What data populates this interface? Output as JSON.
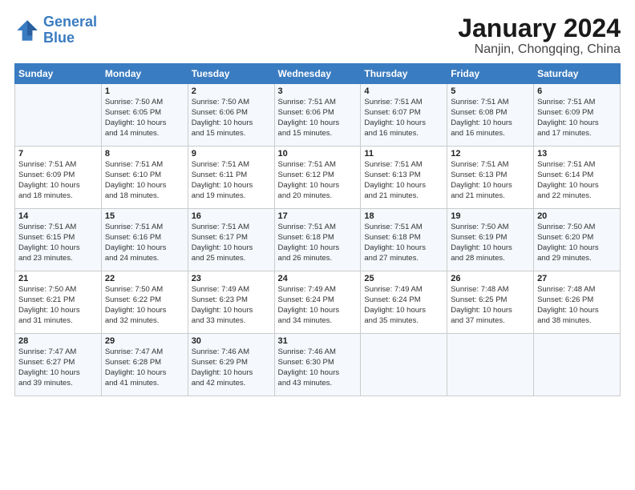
{
  "logo": {
    "line1": "General",
    "line2": "Blue"
  },
  "title": "January 2024",
  "subtitle": "Nanjin, Chongqing, China",
  "headers": [
    "Sunday",
    "Monday",
    "Tuesday",
    "Wednesday",
    "Thursday",
    "Friday",
    "Saturday"
  ],
  "weeks": [
    [
      {
        "num": "",
        "info": ""
      },
      {
        "num": "1",
        "info": "Sunrise: 7:50 AM\nSunset: 6:05 PM\nDaylight: 10 hours\nand 14 minutes."
      },
      {
        "num": "2",
        "info": "Sunrise: 7:50 AM\nSunset: 6:06 PM\nDaylight: 10 hours\nand 15 minutes."
      },
      {
        "num": "3",
        "info": "Sunrise: 7:51 AM\nSunset: 6:06 PM\nDaylight: 10 hours\nand 15 minutes."
      },
      {
        "num": "4",
        "info": "Sunrise: 7:51 AM\nSunset: 6:07 PM\nDaylight: 10 hours\nand 16 minutes."
      },
      {
        "num": "5",
        "info": "Sunrise: 7:51 AM\nSunset: 6:08 PM\nDaylight: 10 hours\nand 16 minutes."
      },
      {
        "num": "6",
        "info": "Sunrise: 7:51 AM\nSunset: 6:09 PM\nDaylight: 10 hours\nand 17 minutes."
      }
    ],
    [
      {
        "num": "7",
        "info": "Sunrise: 7:51 AM\nSunset: 6:09 PM\nDaylight: 10 hours\nand 18 minutes."
      },
      {
        "num": "8",
        "info": "Sunrise: 7:51 AM\nSunset: 6:10 PM\nDaylight: 10 hours\nand 18 minutes."
      },
      {
        "num": "9",
        "info": "Sunrise: 7:51 AM\nSunset: 6:11 PM\nDaylight: 10 hours\nand 19 minutes."
      },
      {
        "num": "10",
        "info": "Sunrise: 7:51 AM\nSunset: 6:12 PM\nDaylight: 10 hours\nand 20 minutes."
      },
      {
        "num": "11",
        "info": "Sunrise: 7:51 AM\nSunset: 6:13 PM\nDaylight: 10 hours\nand 21 minutes."
      },
      {
        "num": "12",
        "info": "Sunrise: 7:51 AM\nSunset: 6:13 PM\nDaylight: 10 hours\nand 21 minutes."
      },
      {
        "num": "13",
        "info": "Sunrise: 7:51 AM\nSunset: 6:14 PM\nDaylight: 10 hours\nand 22 minutes."
      }
    ],
    [
      {
        "num": "14",
        "info": "Sunrise: 7:51 AM\nSunset: 6:15 PM\nDaylight: 10 hours\nand 23 minutes."
      },
      {
        "num": "15",
        "info": "Sunrise: 7:51 AM\nSunset: 6:16 PM\nDaylight: 10 hours\nand 24 minutes."
      },
      {
        "num": "16",
        "info": "Sunrise: 7:51 AM\nSunset: 6:17 PM\nDaylight: 10 hours\nand 25 minutes."
      },
      {
        "num": "17",
        "info": "Sunrise: 7:51 AM\nSunset: 6:18 PM\nDaylight: 10 hours\nand 26 minutes."
      },
      {
        "num": "18",
        "info": "Sunrise: 7:51 AM\nSunset: 6:18 PM\nDaylight: 10 hours\nand 27 minutes."
      },
      {
        "num": "19",
        "info": "Sunrise: 7:50 AM\nSunset: 6:19 PM\nDaylight: 10 hours\nand 28 minutes."
      },
      {
        "num": "20",
        "info": "Sunrise: 7:50 AM\nSunset: 6:20 PM\nDaylight: 10 hours\nand 29 minutes."
      }
    ],
    [
      {
        "num": "21",
        "info": "Sunrise: 7:50 AM\nSunset: 6:21 PM\nDaylight: 10 hours\nand 31 minutes."
      },
      {
        "num": "22",
        "info": "Sunrise: 7:50 AM\nSunset: 6:22 PM\nDaylight: 10 hours\nand 32 minutes."
      },
      {
        "num": "23",
        "info": "Sunrise: 7:49 AM\nSunset: 6:23 PM\nDaylight: 10 hours\nand 33 minutes."
      },
      {
        "num": "24",
        "info": "Sunrise: 7:49 AM\nSunset: 6:24 PM\nDaylight: 10 hours\nand 34 minutes."
      },
      {
        "num": "25",
        "info": "Sunrise: 7:49 AM\nSunset: 6:24 PM\nDaylight: 10 hours\nand 35 minutes."
      },
      {
        "num": "26",
        "info": "Sunrise: 7:48 AM\nSunset: 6:25 PM\nDaylight: 10 hours\nand 37 minutes."
      },
      {
        "num": "27",
        "info": "Sunrise: 7:48 AM\nSunset: 6:26 PM\nDaylight: 10 hours\nand 38 minutes."
      }
    ],
    [
      {
        "num": "28",
        "info": "Sunrise: 7:47 AM\nSunset: 6:27 PM\nDaylight: 10 hours\nand 39 minutes."
      },
      {
        "num": "29",
        "info": "Sunrise: 7:47 AM\nSunset: 6:28 PM\nDaylight: 10 hours\nand 41 minutes."
      },
      {
        "num": "30",
        "info": "Sunrise: 7:46 AM\nSunset: 6:29 PM\nDaylight: 10 hours\nand 42 minutes."
      },
      {
        "num": "31",
        "info": "Sunrise: 7:46 AM\nSunset: 6:30 PM\nDaylight: 10 hours\nand 43 minutes."
      },
      {
        "num": "",
        "info": ""
      },
      {
        "num": "",
        "info": ""
      },
      {
        "num": "",
        "info": ""
      }
    ]
  ]
}
